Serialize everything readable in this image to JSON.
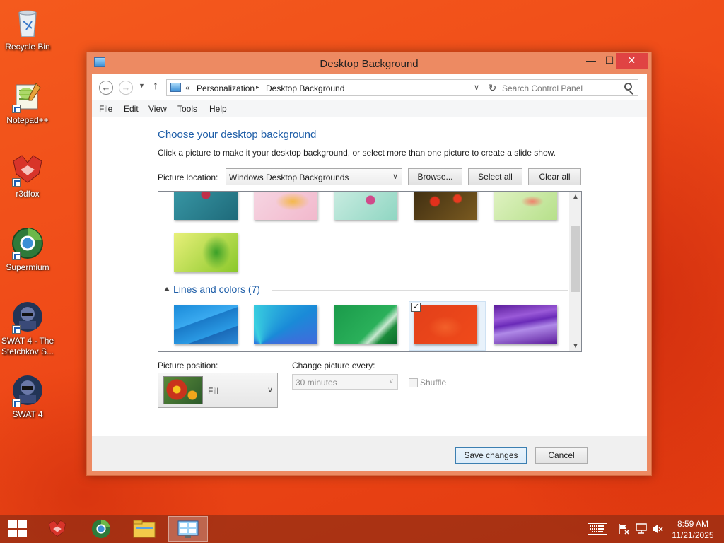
{
  "desktop": {
    "icons": [
      {
        "label": "Recycle Bin"
      },
      {
        "label": "Notepad++"
      },
      {
        "label": "r3dfox"
      },
      {
        "label": "Supermium"
      },
      {
        "label": "SWAT 4 - The Stetchkov S..."
      },
      {
        "label": "SWAT 4"
      }
    ]
  },
  "window": {
    "title": "Desktop Background",
    "min_glyph": "—",
    "max_glyph": "☐",
    "close_glyph": "✕"
  },
  "address": {
    "chevron": "«",
    "crumbs": [
      "Personalization",
      "Desktop Background"
    ],
    "separator": "▸",
    "search_placeholder": "Search Control Panel"
  },
  "menu": [
    "File",
    "Edit",
    "View",
    "Tools",
    "Help"
  ],
  "content": {
    "heading": "Choose your desktop background",
    "instruction": "Click a picture to make it your desktop background, or select more than one picture to create a slide show.",
    "picture_location_label": "Picture location:",
    "picture_location_value": "Windows Desktop Backgrounds",
    "browse_label": "Browse...",
    "select_all_label": "Select all",
    "clear_all_label": "Clear all",
    "group_header": "Lines and colors (7)",
    "selected_checkmark": "✓",
    "picture_position_label": "Picture position:",
    "picture_position_value": "Fill",
    "change_every_label": "Change picture every:",
    "change_every_value": "30 minutes",
    "shuffle_label": "Shuffle"
  },
  "footer": {
    "save_label": "Save changes",
    "cancel_label": "Cancel"
  },
  "taskbar": {
    "time": "8:59 AM",
    "date": "11/21/2025"
  },
  "colors": {
    "accent_blue": "#1e5ea8",
    "window_frame": "#ed8a62",
    "close_red": "#e04343"
  }
}
